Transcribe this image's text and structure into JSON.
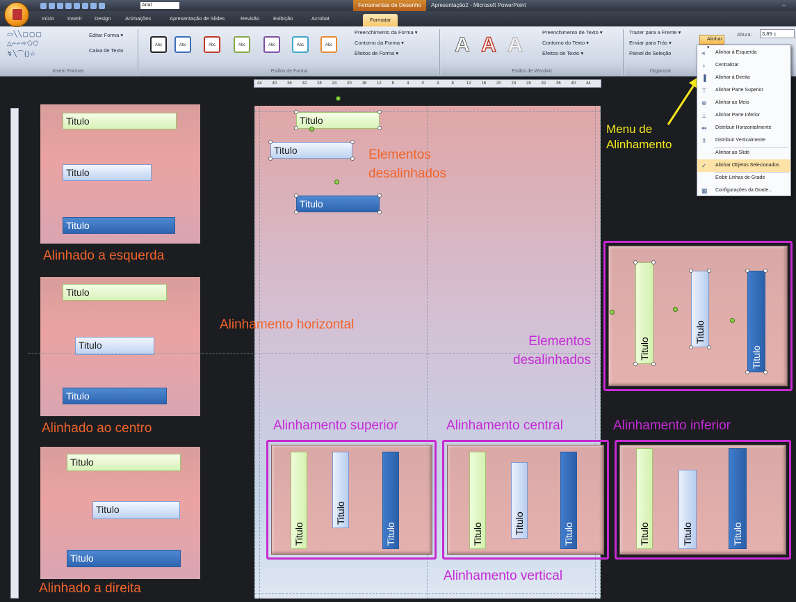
{
  "titlebar": {
    "font_name": "Arial",
    "context_label": "Ferramentas de Desenho",
    "app_title": "Apresentação2 - Microsoft PowerPoint",
    "minimize": "–"
  },
  "tabs": [
    "Início",
    "Inserir",
    "Design",
    "Animações",
    "Apresentação de Slides",
    "Revisão",
    "Exibição",
    "Acrobat",
    "Formatar"
  ],
  "ribbon": {
    "groups": {
      "insert_shapes": "Inserir Formas",
      "shape_styles": "Estilos de Forma",
      "wordart_styles": "Estilos de WordArt",
      "arrange": "Organizar"
    },
    "edit_shape": "Editar Forma ▾",
    "text_box": "Caixa de Texto",
    "shape_style_swatch": "Abc",
    "shape_fill": "Preenchimento da Forma ▾",
    "shape_outline": "Contorno da Forma ▾",
    "shape_effects": "Efeitos de Forma ▾",
    "wordart_letter": "A",
    "text_fill": "Preenchimento de Texto ▾",
    "text_outline": "Contorno do Texto ▾",
    "text_effects": "Efeitos de Texto ▾",
    "bring_front": "Trazer para a Frente ▾",
    "send_back": "Enviar para Trás ▾",
    "selection_pane": "Painel de Seleção",
    "align_button": "Alinhar ▾",
    "height_label": "Altura:",
    "height_value": "3,89 c"
  },
  "ruler_ticks": [
    "44",
    "40",
    "36",
    "32",
    "28",
    "24",
    "20",
    "16",
    "12",
    "8",
    "4",
    "0",
    "4",
    "8",
    "12",
    "16",
    "20",
    "24",
    "28",
    "32",
    "36",
    "40",
    "44"
  ],
  "align_menu": [
    {
      "label": "Alinhar à Esquerda",
      "icon": "align-left-icon",
      "glyph": "⫷"
    },
    {
      "label": "Centralizar",
      "icon": "align-center-icon",
      "glyph": "♁"
    },
    {
      "label": "Alinhar à Direita",
      "icon": "align-right-icon",
      "glyph": "▐"
    },
    {
      "label": "Alinhar Parte Superior",
      "icon": "align-top-icon",
      "glyph": "⊤"
    },
    {
      "label": "Alinhar ao Meio",
      "icon": "align-middle-icon",
      "glyph": "⊕"
    },
    {
      "label": "Alinhar Parte Inferior",
      "icon": "align-bottom-icon",
      "glyph": "⊥"
    },
    {
      "label": "Distribuir Horizontalmente",
      "icon": "distribute-horizontal-icon",
      "glyph": "⇹"
    },
    {
      "label": "Distribuir Verticalmente",
      "icon": "distribute-vertical-icon",
      "glyph": "⇳"
    },
    {
      "label": "Alinhar ao Slide",
      "icon": "",
      "glyph": ""
    },
    {
      "label": "Alinhar Objetos Selecionados",
      "icon": "check-icon",
      "glyph": "✓",
      "checked": true
    },
    {
      "label": "Exibir Linhas de Grade",
      "icon": "",
      "glyph": ""
    },
    {
      "label": "Configurações da Grade...",
      "icon": "grid-settings-icon",
      "glyph": "▦"
    }
  ],
  "annotations": {
    "menu_callout": "Menu de Alinhamento",
    "left_aligned": "Alinhado a esquerda",
    "centered": "Alinhado ao centro",
    "right_aligned": "Alinhado a direita",
    "misaligned_top": "Elementos desalinhados",
    "horizontal_alignment": "Alinhamento horizontal",
    "misaligned_vertical": "Elementos desalinhados",
    "align_top": "Alinhamento superior",
    "align_middle": "Alinhamento central",
    "align_bottom": "Alinhamento inferior",
    "vertical_alignment": "Alinhamento vertical"
  },
  "box_text": "Titulo",
  "colors": {
    "orange_label": "#f0642a",
    "purple_label": "#c52ad6",
    "yellow_label": "#f3e61d",
    "frame": "#c62ad1"
  }
}
